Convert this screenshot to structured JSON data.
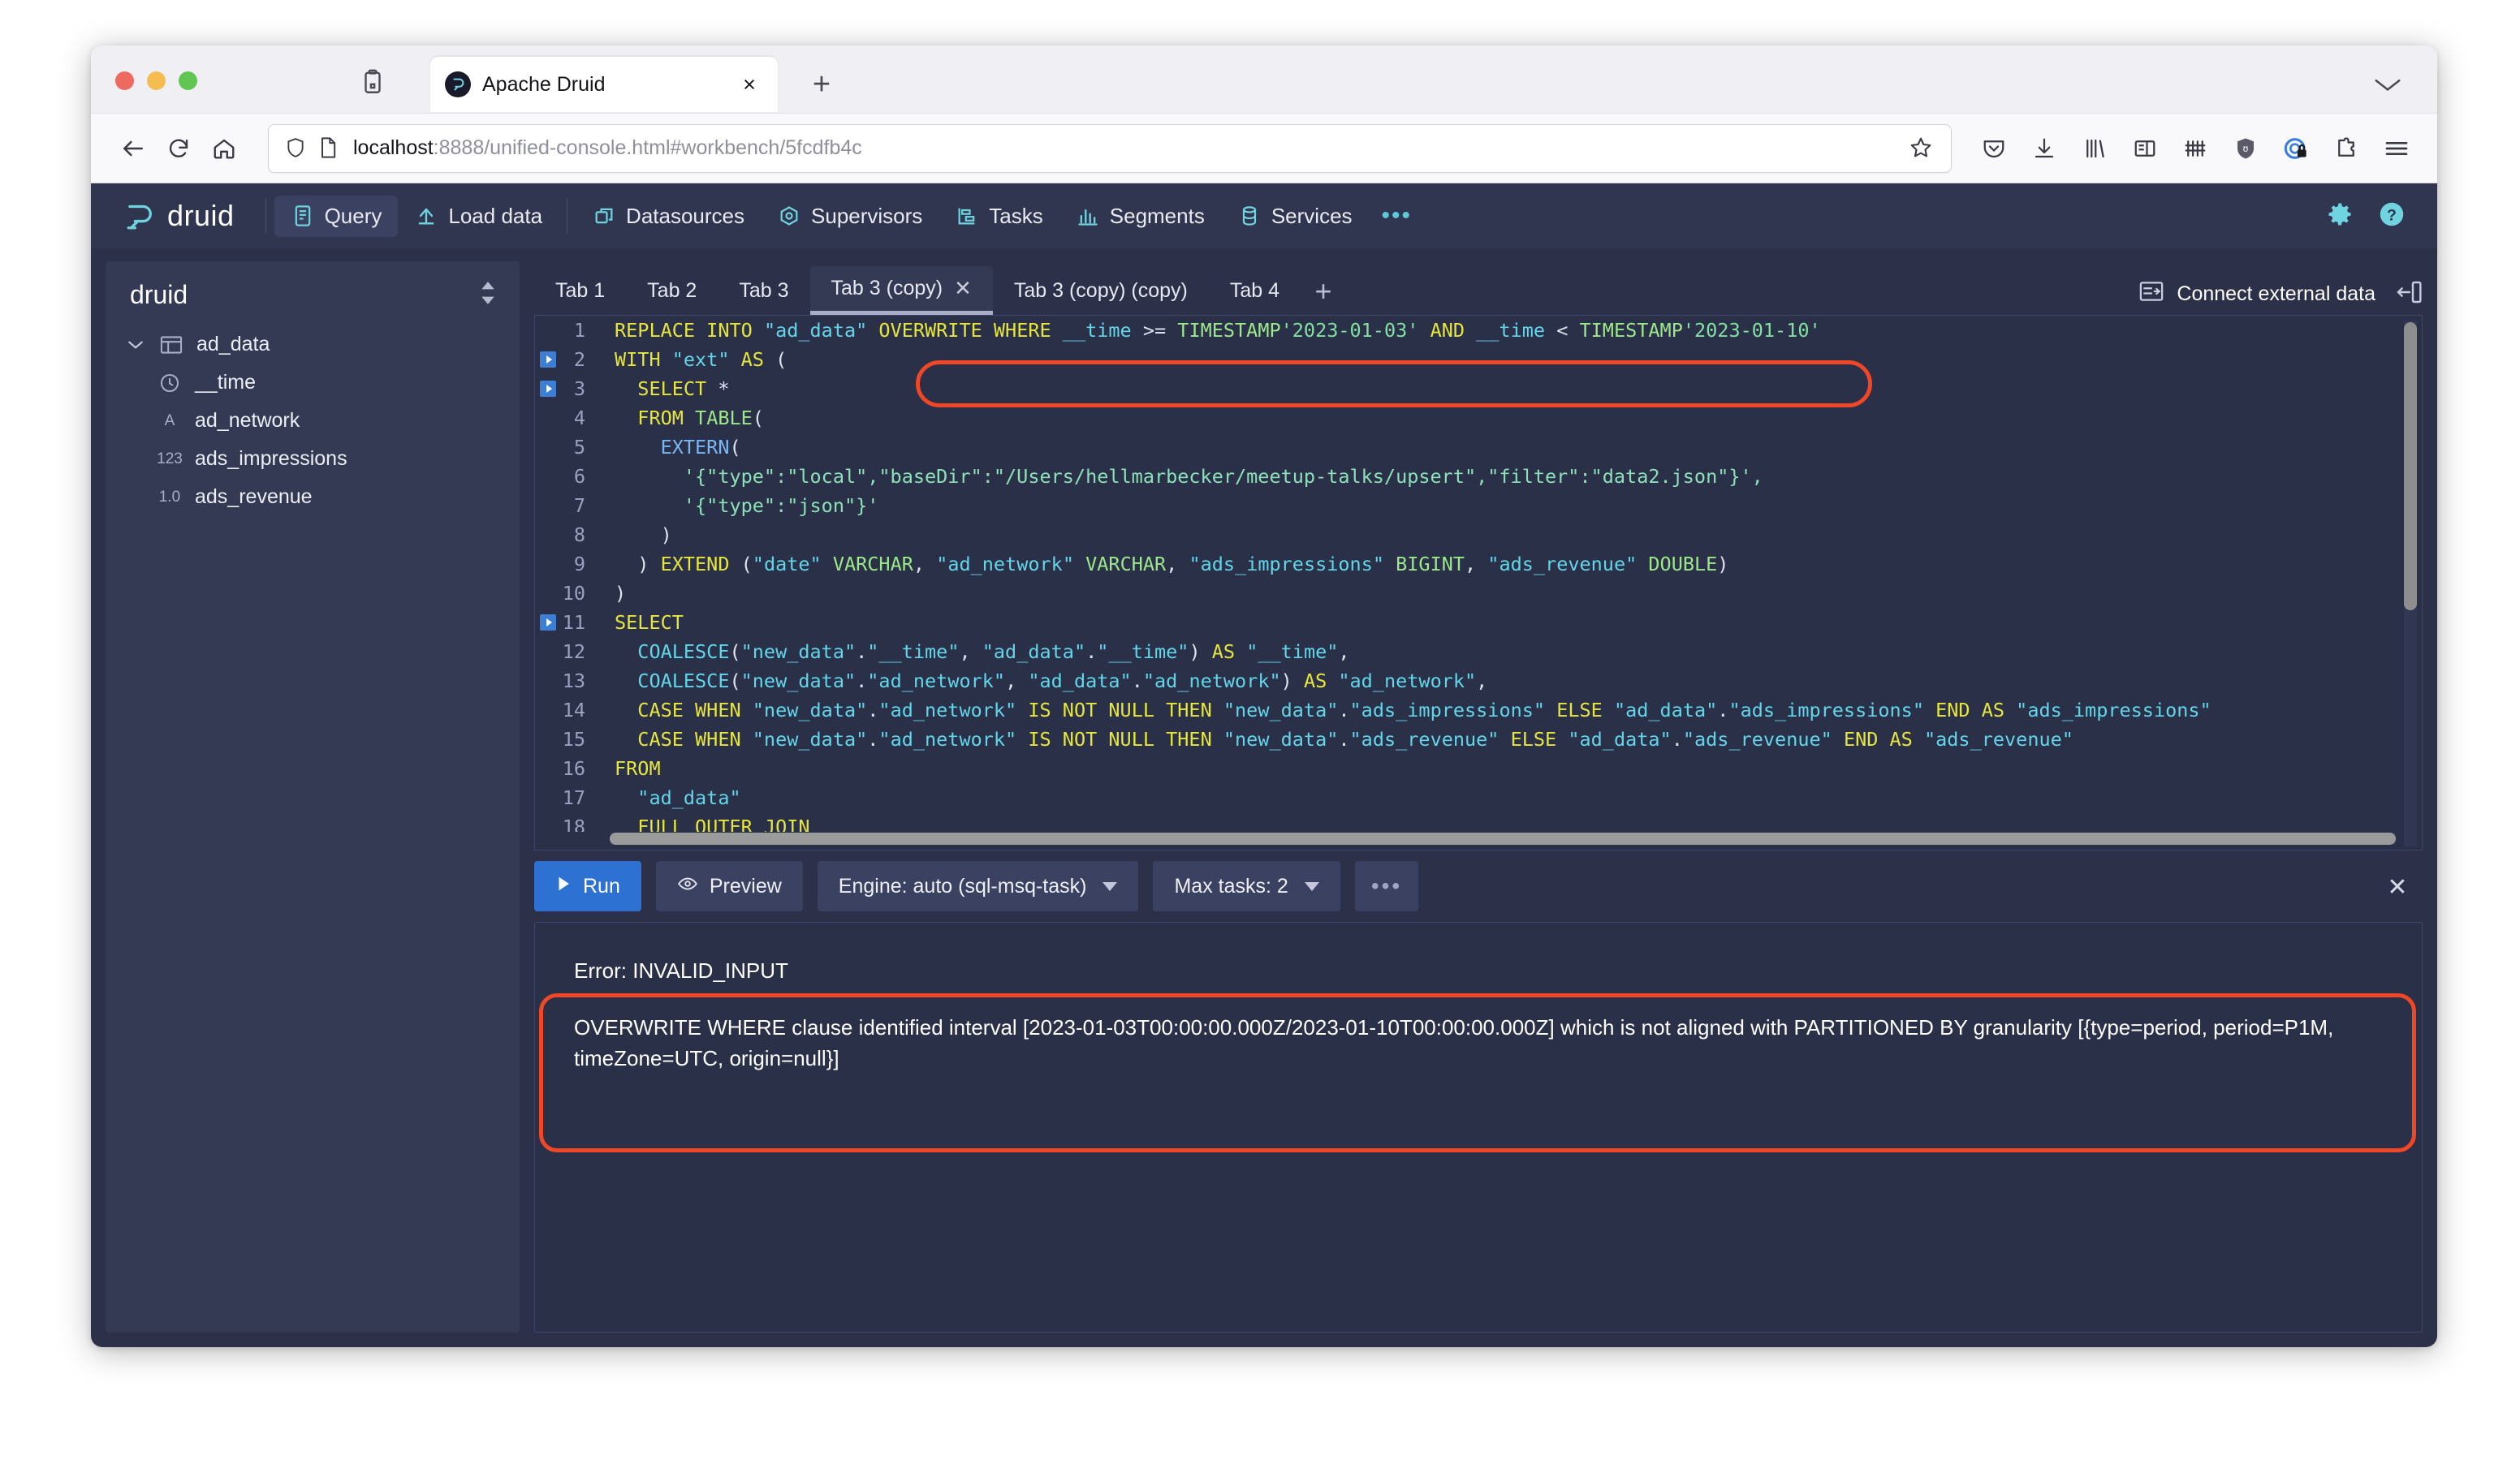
{
  "browser": {
    "tab_title": "Apache Druid",
    "tab_close": "×",
    "new_tab": "+",
    "url_host": "localhost",
    "url_rest": ":8888/unified-console.html#workbench/5fcdfb4c",
    "icons": {
      "back": "back-arrow-icon",
      "forward": "forward-arrow-icon",
      "reload": "reload-icon",
      "home": "home-icon",
      "shield": "shield-icon",
      "page": "page-icon",
      "bookmark": "star-icon",
      "pocket": "pocket-icon",
      "downloads": "downloads-icon",
      "library": "library-icon",
      "reader": "sidebar-icon",
      "containers": "container-tabs-icon",
      "ublock": "ublock-origin-icon",
      "privacy": "privacy-badger-icon",
      "extensions": "extensions-icon",
      "menu": "hamburger-menu-icon"
    }
  },
  "druid": {
    "logo_text": "druid",
    "nav": [
      {
        "label": "Query",
        "icon": "query-icon",
        "active": true
      },
      {
        "label": "Load data",
        "icon": "load-data-icon",
        "active": false
      },
      {
        "label": "Datasources",
        "icon": "datasources-icon",
        "active": false
      },
      {
        "label": "Supervisors",
        "icon": "supervisors-icon",
        "active": false
      },
      {
        "label": "Tasks",
        "icon": "tasks-icon",
        "active": false
      },
      {
        "label": "Segments",
        "icon": "segments-icon",
        "active": false
      },
      {
        "label": "Services",
        "icon": "services-icon",
        "active": false
      }
    ],
    "nav_more": "•••",
    "header_right": [
      "gear-icon",
      "help-icon"
    ]
  },
  "tree": {
    "title": "druid",
    "sort_icon": "sort-icon",
    "nodes": [
      {
        "label": "ad_data",
        "icon": "table-icon",
        "type_label": "",
        "expanded": true,
        "child": false
      },
      {
        "label": "__time",
        "icon": "clock-icon",
        "type_label": "",
        "expanded": false,
        "child": true
      },
      {
        "label": "ad_network",
        "icon": "string-icon",
        "type_label": "A",
        "expanded": false,
        "child": true
      },
      {
        "label": "ads_impressions",
        "icon": "number-icon",
        "type_label": "123",
        "expanded": false,
        "child": true
      },
      {
        "label": "ads_revenue",
        "icon": "float-icon",
        "type_label": "1.0",
        "expanded": false,
        "child": true
      }
    ]
  },
  "query_tabs": {
    "items": [
      {
        "label": "Tab 1",
        "active": false,
        "closable": false
      },
      {
        "label": "Tab 2",
        "active": false,
        "closable": false
      },
      {
        "label": "Tab 3",
        "active": false,
        "closable": false
      },
      {
        "label": "Tab 3 (copy)",
        "active": true,
        "closable": true
      },
      {
        "label": "Tab 3 (copy) (copy)",
        "active": false,
        "closable": false
      },
      {
        "label": "Tab 4",
        "active": false,
        "closable": false
      }
    ],
    "add_label": "+",
    "close_glyph": "✕",
    "connect_external_label": "Connect external data",
    "collapse_icon": "collapse-panel-icon"
  },
  "editor": {
    "lines": [
      {
        "n": "1",
        "fold": false,
        "tokens": [
          {
            "t": "REPLACE INTO ",
            "c": "kw"
          },
          {
            "t": "\"ad_data\" ",
            "c": "fn"
          },
          {
            "t": "OVERWRITE WHERE ",
            "c": "kw"
          },
          {
            "t": "__time ",
            "c": "fn"
          },
          {
            "t": ">= ",
            "c": "pun"
          },
          {
            "t": "TIMESTAMP",
            "c": "typ"
          },
          {
            "t": "'2023-01-03' ",
            "c": "str"
          },
          {
            "t": "AND ",
            "c": "kw"
          },
          {
            "t": "__time ",
            "c": "fn"
          },
          {
            "t": "< ",
            "c": "pun"
          },
          {
            "t": "TIMESTAMP",
            "c": "typ"
          },
          {
            "t": "'2023-01-10'",
            "c": "str"
          }
        ]
      },
      {
        "n": "2",
        "fold": true,
        "tokens": [
          {
            "t": "WITH ",
            "c": "kw"
          },
          {
            "t": "\"ext\" ",
            "c": "fn"
          },
          {
            "t": "AS",
            "c": "kw"
          },
          {
            "t": " (",
            "c": "pun"
          }
        ]
      },
      {
        "n": "3",
        "fold": true,
        "tokens": [
          {
            "t": "  SELECT ",
            "c": "kw"
          },
          {
            "t": "*",
            "c": "pun"
          }
        ]
      },
      {
        "n": "4",
        "fold": false,
        "tokens": [
          {
            "t": "  FROM ",
            "c": "kw"
          },
          {
            "t": "TABLE",
            "c": "typ"
          },
          {
            "t": "(",
            "c": "pun"
          }
        ]
      },
      {
        "n": "5",
        "fold": false,
        "tokens": [
          {
            "t": "    EXTERN",
            "c": "ext"
          },
          {
            "t": "(",
            "c": "pun"
          }
        ]
      },
      {
        "n": "6",
        "fold": false,
        "tokens": [
          {
            "t": "      '{\"type\":\"local\",\"baseDir\":\"/Users/hellmarbecker/meetup-talks/upsert\",\"filter\":\"data2.json\"}',",
            "c": "lit"
          }
        ]
      },
      {
        "n": "7",
        "fold": false,
        "tokens": [
          {
            "t": "      '{\"type\":\"json\"}'",
            "c": "lit"
          }
        ]
      },
      {
        "n": "8",
        "fold": false,
        "tokens": [
          {
            "t": "    )",
            "c": "pun"
          }
        ]
      },
      {
        "n": "9",
        "fold": false,
        "tokens": [
          {
            "t": "  ) ",
            "c": "pun"
          },
          {
            "t": "EXTEND ",
            "c": "kw"
          },
          {
            "t": "(",
            "c": "pun"
          },
          {
            "t": "\"date\" ",
            "c": "fn"
          },
          {
            "t": "VARCHAR",
            "c": "typ"
          },
          {
            "t": ", ",
            "c": "pun"
          },
          {
            "t": "\"ad_network\" ",
            "c": "fn"
          },
          {
            "t": "VARCHAR",
            "c": "typ"
          },
          {
            "t": ", ",
            "c": "pun"
          },
          {
            "t": "\"ads_impressions\" ",
            "c": "fn"
          },
          {
            "t": "BIGINT",
            "c": "typ"
          },
          {
            "t": ", ",
            "c": "pun"
          },
          {
            "t": "\"ads_revenue\" ",
            "c": "fn"
          },
          {
            "t": "DOUBLE",
            "c": "typ"
          },
          {
            "t": ")",
            "c": "pun"
          }
        ]
      },
      {
        "n": "10",
        "fold": false,
        "tokens": [
          {
            "t": ")",
            "c": "pun"
          }
        ]
      },
      {
        "n": "11",
        "fold": true,
        "tokens": [
          {
            "t": "SELECT",
            "c": "kw"
          }
        ]
      },
      {
        "n": "12",
        "fold": false,
        "tokens": [
          {
            "t": "  COALESCE",
            "c": "fn"
          },
          {
            "t": "(",
            "c": "pun"
          },
          {
            "t": "\"new_data\"",
            "c": "fn"
          },
          {
            "t": ".",
            "c": "pun"
          },
          {
            "t": "\"__time\"",
            "c": "fn"
          },
          {
            "t": ", ",
            "c": "pun"
          },
          {
            "t": "\"ad_data\"",
            "c": "fn"
          },
          {
            "t": ".",
            "c": "pun"
          },
          {
            "t": "\"__time\"",
            "c": "fn"
          },
          {
            "t": ") ",
            "c": "pun"
          },
          {
            "t": "AS ",
            "c": "kw"
          },
          {
            "t": "\"__time\"",
            "c": "fn"
          },
          {
            "t": ",",
            "c": "pun"
          }
        ]
      },
      {
        "n": "13",
        "fold": false,
        "tokens": [
          {
            "t": "  COALESCE",
            "c": "fn"
          },
          {
            "t": "(",
            "c": "pun"
          },
          {
            "t": "\"new_data\"",
            "c": "fn"
          },
          {
            "t": ".",
            "c": "pun"
          },
          {
            "t": "\"ad_network\"",
            "c": "fn"
          },
          {
            "t": ", ",
            "c": "pun"
          },
          {
            "t": "\"ad_data\"",
            "c": "fn"
          },
          {
            "t": ".",
            "c": "pun"
          },
          {
            "t": "\"ad_network\"",
            "c": "fn"
          },
          {
            "t": ") ",
            "c": "pun"
          },
          {
            "t": "AS ",
            "c": "kw"
          },
          {
            "t": "\"ad_network\"",
            "c": "fn"
          },
          {
            "t": ",",
            "c": "pun"
          }
        ]
      },
      {
        "n": "14",
        "fold": false,
        "tokens": [
          {
            "t": "  CASE WHEN ",
            "c": "kw"
          },
          {
            "t": "\"new_data\"",
            "c": "fn"
          },
          {
            "t": ".",
            "c": "pun"
          },
          {
            "t": "\"ad_network\" ",
            "c": "fn"
          },
          {
            "t": "IS NOT NULL THEN ",
            "c": "kw"
          },
          {
            "t": "\"new_data\"",
            "c": "fn"
          },
          {
            "t": ".",
            "c": "pun"
          },
          {
            "t": "\"ads_impressions\" ",
            "c": "fn"
          },
          {
            "t": "ELSE ",
            "c": "kw"
          },
          {
            "t": "\"ad_data\"",
            "c": "fn"
          },
          {
            "t": ".",
            "c": "pun"
          },
          {
            "t": "\"ads_impressions\" ",
            "c": "fn"
          },
          {
            "t": "END AS ",
            "c": "kw"
          },
          {
            "t": "\"ads_impressions\"",
            "c": "fn"
          }
        ]
      },
      {
        "n": "15",
        "fold": false,
        "tokens": [
          {
            "t": "  CASE WHEN ",
            "c": "kw"
          },
          {
            "t": "\"new_data\"",
            "c": "fn"
          },
          {
            "t": ".",
            "c": "pun"
          },
          {
            "t": "\"ad_network\" ",
            "c": "fn"
          },
          {
            "t": "IS NOT NULL THEN ",
            "c": "kw"
          },
          {
            "t": "\"new_data\"",
            "c": "fn"
          },
          {
            "t": ".",
            "c": "pun"
          },
          {
            "t": "\"ads_revenue\" ",
            "c": "fn"
          },
          {
            "t": "ELSE ",
            "c": "kw"
          },
          {
            "t": "\"ad_data\"",
            "c": "fn"
          },
          {
            "t": ".",
            "c": "pun"
          },
          {
            "t": "\"ads_revenue\" ",
            "c": "fn"
          },
          {
            "t": "END AS ",
            "c": "kw"
          },
          {
            "t": "\"ads_revenue\"",
            "c": "fn"
          }
        ]
      },
      {
        "n": "16",
        "fold": false,
        "tokens": [
          {
            "t": "FROM",
            "c": "kw"
          }
        ]
      },
      {
        "n": "17",
        "fold": false,
        "tokens": [
          {
            "t": "  \"ad_data\"",
            "c": "fn"
          }
        ]
      },
      {
        "n": "18",
        "fold": false,
        "tokens": [
          {
            "t": "  FULL OUTER JOIN",
            "c": "kw"
          }
        ]
      }
    ]
  },
  "toolbar": {
    "run_label": "Run",
    "run_icon": "play-icon",
    "preview_label": "Preview",
    "preview_icon": "eye-icon",
    "engine_label": "Engine: auto (sql-msq-task)",
    "max_tasks_label": "Max tasks: 2",
    "more_label": "•••",
    "close_glyph": "✕"
  },
  "result": {
    "error_title": "Error: INVALID_INPUT",
    "error_body": "OVERWRITE WHERE clause identified interval [2023-01-03T00:00:00.000Z/2023-01-10T00:00:00.000Z] which is not aligned with PARTITIONED BY granularity [{type=period, period=P1M, timeZone=UTC, origin=null}]"
  },
  "annotations": {
    "accent_color": "#f04726",
    "items": [
      {
        "name": "overwrite-where-highlight"
      },
      {
        "name": "error-message-highlight"
      }
    ]
  },
  "colors": {
    "app_bg": "#2c3049",
    "panel_bg": "#343a54",
    "editor_bg": "#2b3049",
    "header_bg": "#30364f",
    "primary_button": "#2d72d2",
    "druid_cyan": "#5ec8d8"
  }
}
